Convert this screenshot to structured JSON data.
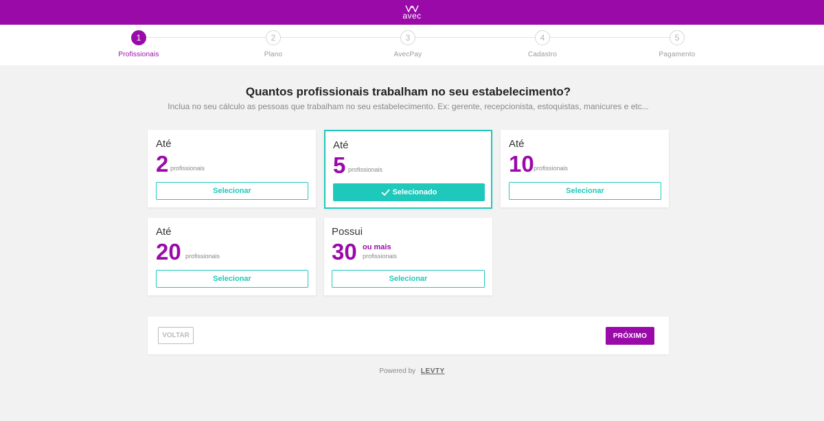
{
  "app": {
    "logo_text": "avec"
  },
  "steps": [
    {
      "number": "1",
      "label": "Profissionais",
      "active": true
    },
    {
      "number": "2",
      "label": "Plano",
      "active": false
    },
    {
      "number": "3",
      "label": "AvecPay",
      "active": false
    },
    {
      "number": "4",
      "label": "Cadastro",
      "active": false
    },
    {
      "number": "5",
      "label": "Pagamento",
      "active": false
    }
  ],
  "main": {
    "title": "Quantos profissionais trabalham no seu estabelecimento?",
    "subtitle": "Inclua no seu cálculo as pessoas que trabalham no seu estabelecimento. Ex: gerente, recepcionista, estoquistas, manicures e etc..."
  },
  "options": [
    {
      "prefix": "Até",
      "value": "2",
      "unit": "profissionais",
      "extra": "",
      "button": "Selecionar",
      "selected": false
    },
    {
      "prefix": "Até",
      "value": "5",
      "unit": "profissionais",
      "extra": "",
      "button": "Selecionado",
      "selected": true
    },
    {
      "prefix": "Até",
      "value": "10",
      "unit": "profissionais",
      "extra": "",
      "button": "Selecionar",
      "selected": false
    },
    {
      "prefix": "Até",
      "value": "20",
      "unit": "profissionais",
      "extra": "",
      "button": "Selecionar",
      "selected": false
    },
    {
      "prefix": "Possui",
      "value": "30",
      "unit": "profissionais",
      "extra": "ou mais",
      "button": "Selecionar",
      "selected": false
    }
  ],
  "nav": {
    "back_label": "VOLTAR",
    "next_label": "PRÓXIMO"
  },
  "footer": {
    "powered_by": "Powered by",
    "brand": "LEVTY"
  },
  "colors": {
    "brand": "#9a0aa9",
    "accent": "#1ec8bb",
    "background": "#f2f2f2"
  }
}
